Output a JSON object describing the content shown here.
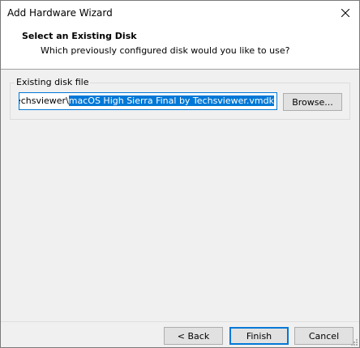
{
  "window": {
    "title": "Add Hardware Wizard",
    "close_icon": "close-icon"
  },
  "header": {
    "title": "Select an Existing Disk",
    "subtitle": "Which previously configured disk would you like to use?"
  },
  "disk_group": {
    "label": "Existing disk file",
    "path_prefix": "al by Techsviewer\\",
    "path_selected": "macOS High Sierra Final by Techsviewer.vmdk",
    "browse_label": "Browse..."
  },
  "footer": {
    "back_label": "< Back",
    "finish_label": "Finish",
    "cancel_label": "Cancel"
  },
  "colors": {
    "accent": "#0078d7",
    "dialog_bg": "#f0f0f0",
    "header_bg": "#ffffff",
    "button_bg": "#e1e1e1"
  }
}
